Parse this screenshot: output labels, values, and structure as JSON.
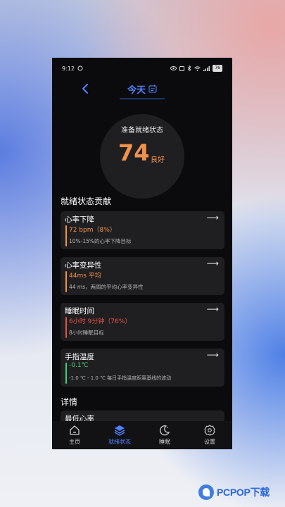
{
  "status_bar": {
    "time": "9:12",
    "battery": "76"
  },
  "header": {
    "title": "今天"
  },
  "score": {
    "label": "准备就绪状态",
    "value": "74",
    "grade": "良好"
  },
  "contrib_title": "就绪状态贡献",
  "cards": [
    {
      "title": "心率下降",
      "value": "72 bpm（8%）",
      "desc": "10%-15%的心率下降目标",
      "color": "#f2924a"
    },
    {
      "title": "心率变异性",
      "value": "44ms 平均",
      "desc": "44 ms，两周的平均心率变异性",
      "color": "#f2924a"
    },
    {
      "title": "睡眠时间",
      "value": "6小时 9分钟（76%）",
      "desc": "8小时睡眠目标",
      "color": "#e8523f"
    },
    {
      "title": "手指温度",
      "value": "-0.1℃",
      "desc": "-1.0 ℃ - 1.0 ℃ 每日手指温度距离基线的波动",
      "color": "#3fcf74"
    }
  ],
  "details_title": "详情",
  "details_first_item": "最低心率",
  "nav": [
    {
      "label": "主页",
      "icon": "home-icon"
    },
    {
      "label": "就绪状态",
      "icon": "layers-icon"
    },
    {
      "label": "睡眠",
      "icon": "moon-icon"
    },
    {
      "label": "设置",
      "icon": "gear-icon"
    }
  ],
  "watermark": {
    "brand": "PCPOP下载"
  },
  "colors": {
    "accent": "#4f80ff",
    "score": "#f2924a",
    "card_bg": "#1f1f22"
  }
}
